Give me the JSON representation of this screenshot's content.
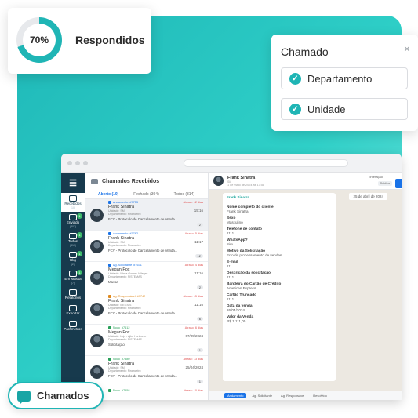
{
  "stat": {
    "percent": "70%",
    "percent_value": 70,
    "label": "Respondidos"
  },
  "ticket": {
    "title": "Chamado",
    "close": "×",
    "options": [
      {
        "label": "Departamento",
        "check": "✓"
      },
      {
        "label": "Unidade",
        "check": "✓"
      }
    ]
  },
  "badge": {
    "label": "Chamados"
  },
  "app": {
    "header": "Chamados Recebidos",
    "tabs": [
      "Aberto (10)",
      "Fechado (304)",
      "Todos (314)"
    ],
    "sidebar": [
      {
        "label": "Recebidos",
        "count": "(10)"
      },
      {
        "label": "Enviado",
        "count": "(307)"
      },
      {
        "label": "Todos",
        "count": "(317)"
      },
      {
        "label": "Bkg",
        "count": "(2)"
      },
      {
        "label": "Em Massa",
        "count": "(7)"
      },
      {
        "label": "Relatórios",
        "count": ""
      },
      {
        "label": "Exportar",
        "count": ""
      },
      {
        "label": "Parâmetros",
        "count": ""
      }
    ],
    "tickets": [
      {
        "status": "Andamento",
        "id": "#7753",
        "late": "Atraso: 12 dias",
        "name": "Frank Sinatra",
        "sub1": "Unidade: SM",
        "sub2": "Departamento: Financeiro",
        "time": "15:16",
        "msg": "FCV - Protocolo de Cancelamento de Venda...",
        "num": "2"
      },
      {
        "status": "Andamento",
        "id": "#7762",
        "late": "Atraso: 5 dias",
        "name": "Frank Sinatra",
        "sub1": "Unidade: SM",
        "sub2": "Departamento: Financeiro",
        "time": "11:17",
        "msg": "FCV - Protocolo de Cancelamento de Venda...",
        "num": "12"
      },
      {
        "status": "Ag. Solicitante",
        "id": "#7631",
        "late": "Atraso: 4 dias",
        "name": "Megan Fox",
        "sub1": "Unidade: Mirna Gomes Villegas",
        "sub2": "Departamento: SISTEMAS",
        "time": "11:16",
        "msg": "Massa",
        "num": "2"
      },
      {
        "status": "Ag. Responsável",
        "id": "#7742",
        "late": "Atraso: 15 dias",
        "name": "Frank Sinatra",
        "sub1": "Unidade: MEGSIS",
        "sub2": "Departamento: Financeiro",
        "time": "11:16",
        "msg": "FCV - Protocolo de Cancelamento de Venda...",
        "num": "6"
      },
      {
        "status": "Novo",
        "id": "#7612",
        "late": "Atraso: 6 dias",
        "name": "Megan Fox",
        "sub1": "Unidade: Lojs - Ajko Horizonte",
        "sub2": "Departamento: SISTEMAS",
        "time": "07/05/2024",
        "msg": "Solicitação",
        "num": "1"
      },
      {
        "status": "Novo",
        "id": "#7580",
        "late": "Atraso: 13 dias",
        "name": "Frank Sinatra",
        "sub1": "Unidade: SM",
        "sub2": "Departamento: Financeiro",
        "time": "25/04/2024",
        "msg": "FCV - Protocolo de Cancelamento de Venda...",
        "num": "1"
      },
      {
        "status": "Novo",
        "id": "#7558",
        "late": "Atraso: 10 dias",
        "name": "",
        "sub1": "",
        "sub2": "",
        "time": "",
        "msg": "",
        "num": ""
      }
    ],
    "chat": {
      "name": "Frank Sinatra",
      "sid": "SM",
      "date": "1 de maio de 2024 às 17:58",
      "interaction": "Interação",
      "public": "Pública",
      "from": "Frank Sinatra",
      "datechip": "25 de abril de 2024",
      "fields": [
        {
          "k": "Nome completo do cliente",
          "v": "Frank Sinatra"
        },
        {
          "k": "Sexo",
          "v": "Masculino"
        },
        {
          "k": "Telefone de contato",
          "v": "1111"
        },
        {
          "k": "WhatsApp?",
          "v": "Sim"
        },
        {
          "k": "Motivo da Solicitação",
          "v": "Erro de processamento de vendas"
        },
        {
          "k": "E-mail",
          "v": "111"
        },
        {
          "k": "Descrição da solicitação",
          "v": "1111"
        },
        {
          "k": "Bandeira do Cartão de Crédito",
          "v": "American Express"
        },
        {
          "k": "Cartão Truncado",
          "v": "1111"
        },
        {
          "k": "Data da venda",
          "v": "26/04/2024"
        },
        {
          "k": "Valor da Venda",
          "v": "R$ 1.111,00"
        }
      ],
      "footer": [
        "Andamento",
        "Ag. Solicitante",
        "Ag. Responsável",
        "Resolvido"
      ]
    }
  },
  "colors": {
    "teal": "#1fb5b5",
    "navy": "#173a4d",
    "blue": "#1a73e8"
  }
}
